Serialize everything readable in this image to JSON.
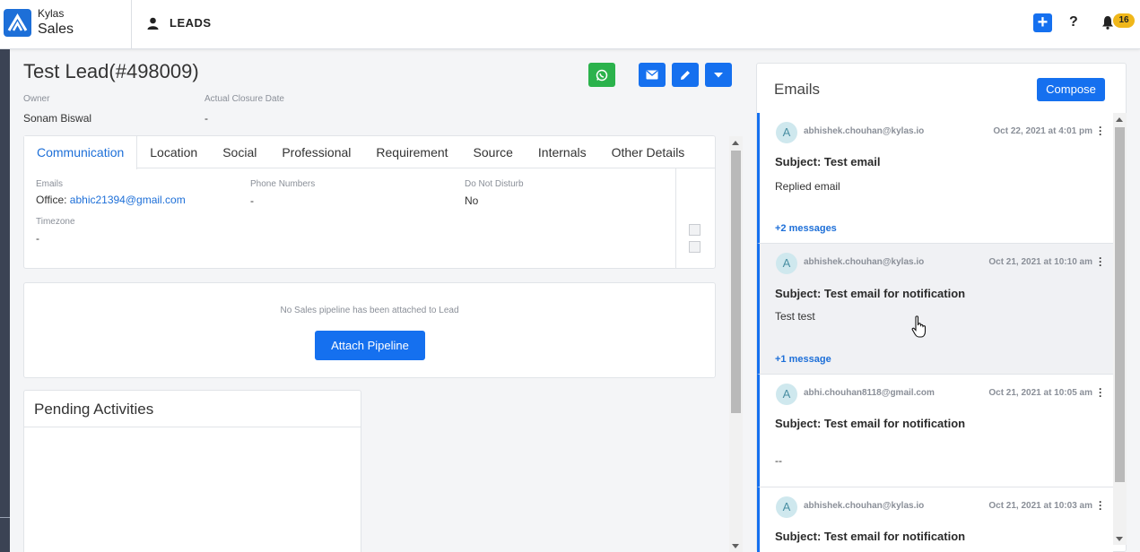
{
  "app": {
    "brand_top": "Kylas",
    "brand_bottom": "Sales",
    "entity": "LEADS",
    "notification_count": "16",
    "help": "?"
  },
  "lead": {
    "title": "Test Lead(#498009)",
    "owner_label": "Owner",
    "owner": "Sonam Biswal",
    "closure_label": "Actual Closure Date",
    "closure": "-"
  },
  "tabs": [
    "Communication",
    "Location",
    "Social",
    "Professional",
    "Requirement",
    "Source",
    "Internals",
    "Other Details"
  ],
  "communication": {
    "emails_label": "Emails",
    "email_prefix": "Office: ",
    "email": "abhic21394@gmail.com",
    "phone_label": "Phone Numbers",
    "phone": "-",
    "dnd_label": "Do Not Disturb",
    "dnd": "No",
    "timezone_label": "Timezone",
    "timezone": "-"
  },
  "pipeline": {
    "message": "No Sales pipeline has been attached to Lead",
    "button": "Attach Pipeline"
  },
  "pending": {
    "title": "Pending Activities"
  },
  "emails": {
    "title": "Emails",
    "compose": "Compose",
    "items": [
      {
        "avatar": "A",
        "from": "abhishek.chouhan@kylas.io",
        "date": "Oct 22, 2021 at 4:01 pm",
        "subject": "Subject: Test email",
        "body": "Replied email",
        "more": "+2 messages"
      },
      {
        "avatar": "A",
        "from": "abhishek.chouhan@kylas.io",
        "date": "Oct 21, 2021 at 10:10 am",
        "subject": "Subject: Test email for notification",
        "body": "Test test",
        "more": "+1 message"
      },
      {
        "avatar": "A",
        "from": "abhi.chouhan8118@gmail.com",
        "date": "Oct 21, 2021 at 10:05 am",
        "subject": "Subject: Test email for notification",
        "body": "--",
        "more": ""
      },
      {
        "avatar": "A",
        "from": "abhishek.chouhan@kylas.io",
        "date": "Oct 21, 2021 at 10:03 am",
        "subject": "Subject: Test email for notification",
        "body": "",
        "more": ""
      }
    ]
  },
  "colors": {
    "accent": "#1570ef",
    "whatsapp": "#2bb24c",
    "badge": "#f0b71a"
  }
}
